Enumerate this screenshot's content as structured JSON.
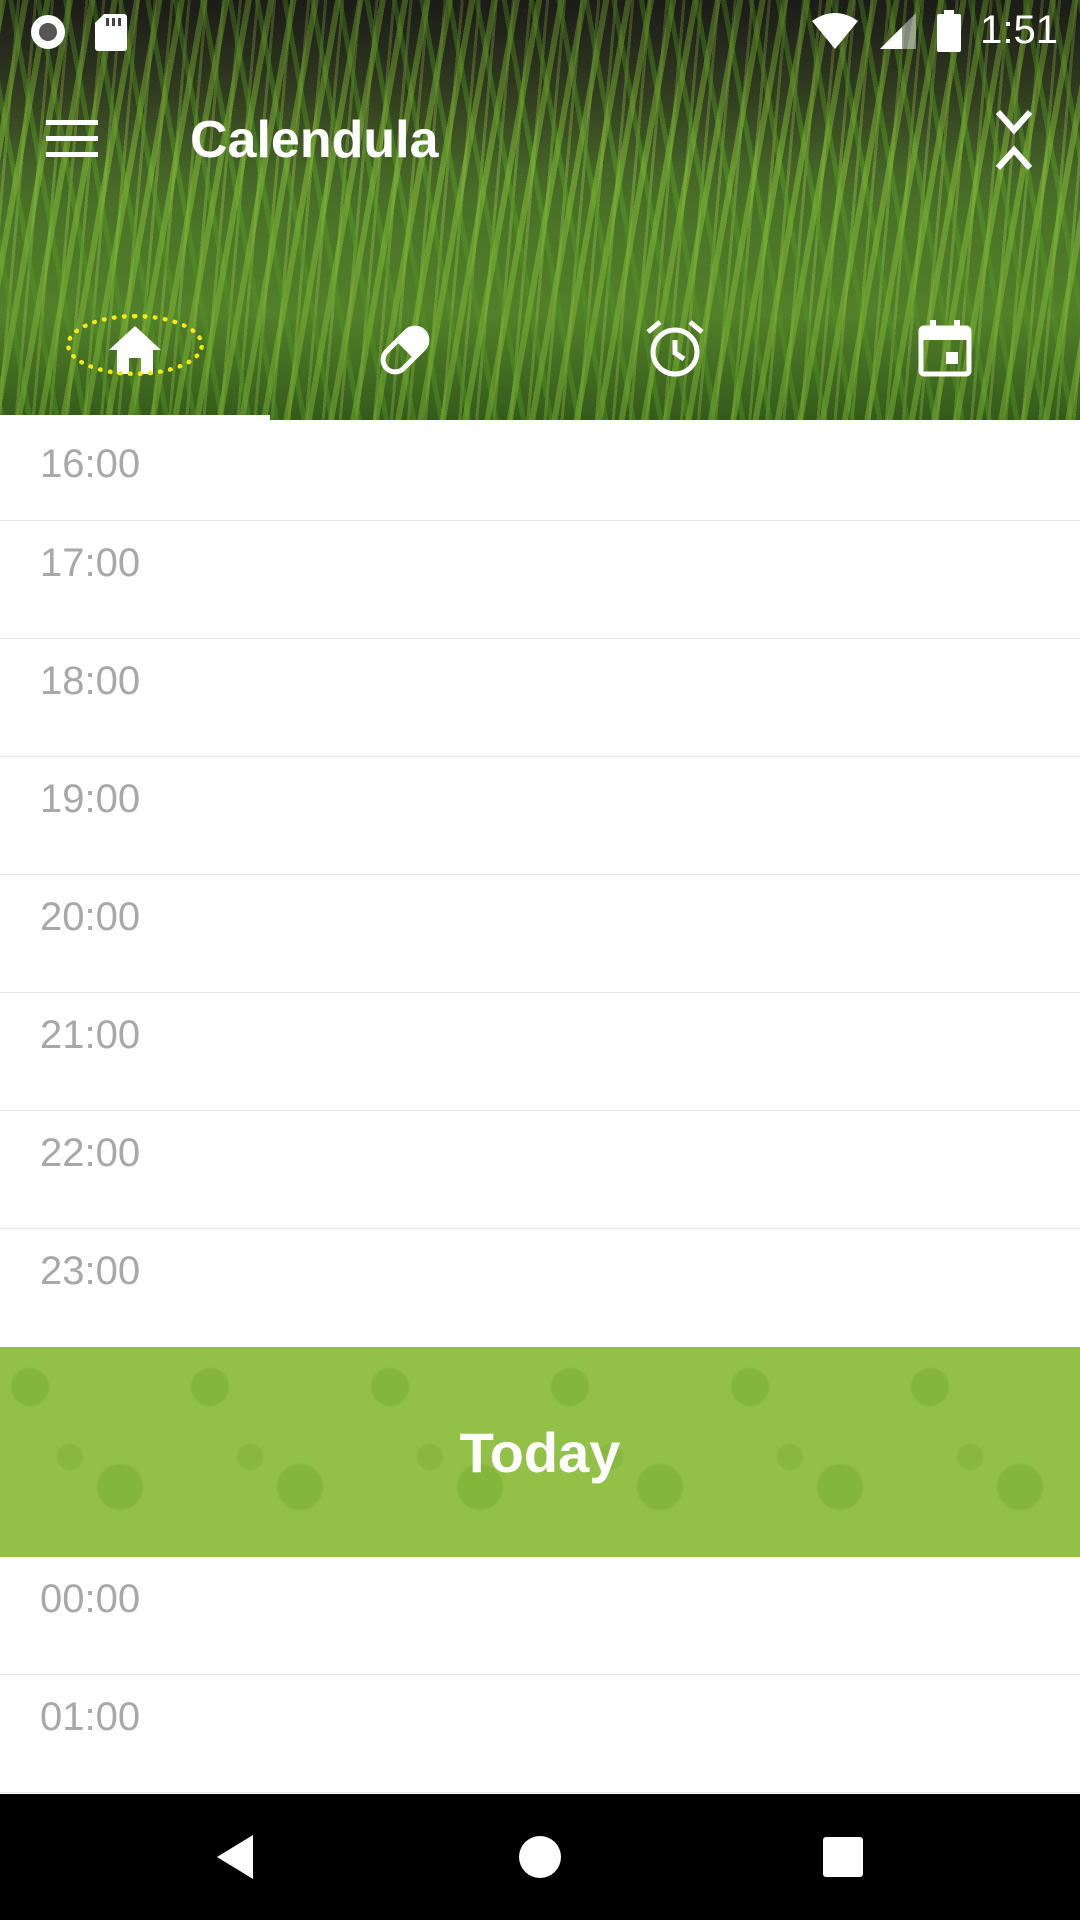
{
  "status_bar": {
    "time": "1:51",
    "icons": [
      "record-icon",
      "sd-card-icon",
      "wifi-icon",
      "cell-signal-icon",
      "battery-icon"
    ]
  },
  "toolbar": {
    "title": "Calendula",
    "menu_icon": "menu-icon",
    "collapse_icon": "collapse-expand-icon"
  },
  "tabs": [
    {
      "name": "home",
      "icon": "home-icon",
      "active": true
    },
    {
      "name": "medicines",
      "icon": "pill-icon",
      "active": false
    },
    {
      "name": "alarms",
      "icon": "alarm-icon",
      "active": false
    },
    {
      "name": "calendar",
      "icon": "calendar-icon",
      "active": false
    }
  ],
  "timeline": {
    "previous_hours": [
      "16:00",
      "17:00",
      "18:00",
      "19:00",
      "20:00",
      "21:00",
      "22:00",
      "23:00"
    ],
    "day_label": "Today",
    "next_hours": [
      "00:00",
      "01:00"
    ]
  },
  "colors": {
    "today_banner": "#93c047",
    "hour_text": "#a8a8a8",
    "highlight": "#f2ea1a"
  },
  "nav_bar": {
    "icons": [
      "back-icon",
      "home-circle-icon",
      "recents-icon"
    ]
  }
}
